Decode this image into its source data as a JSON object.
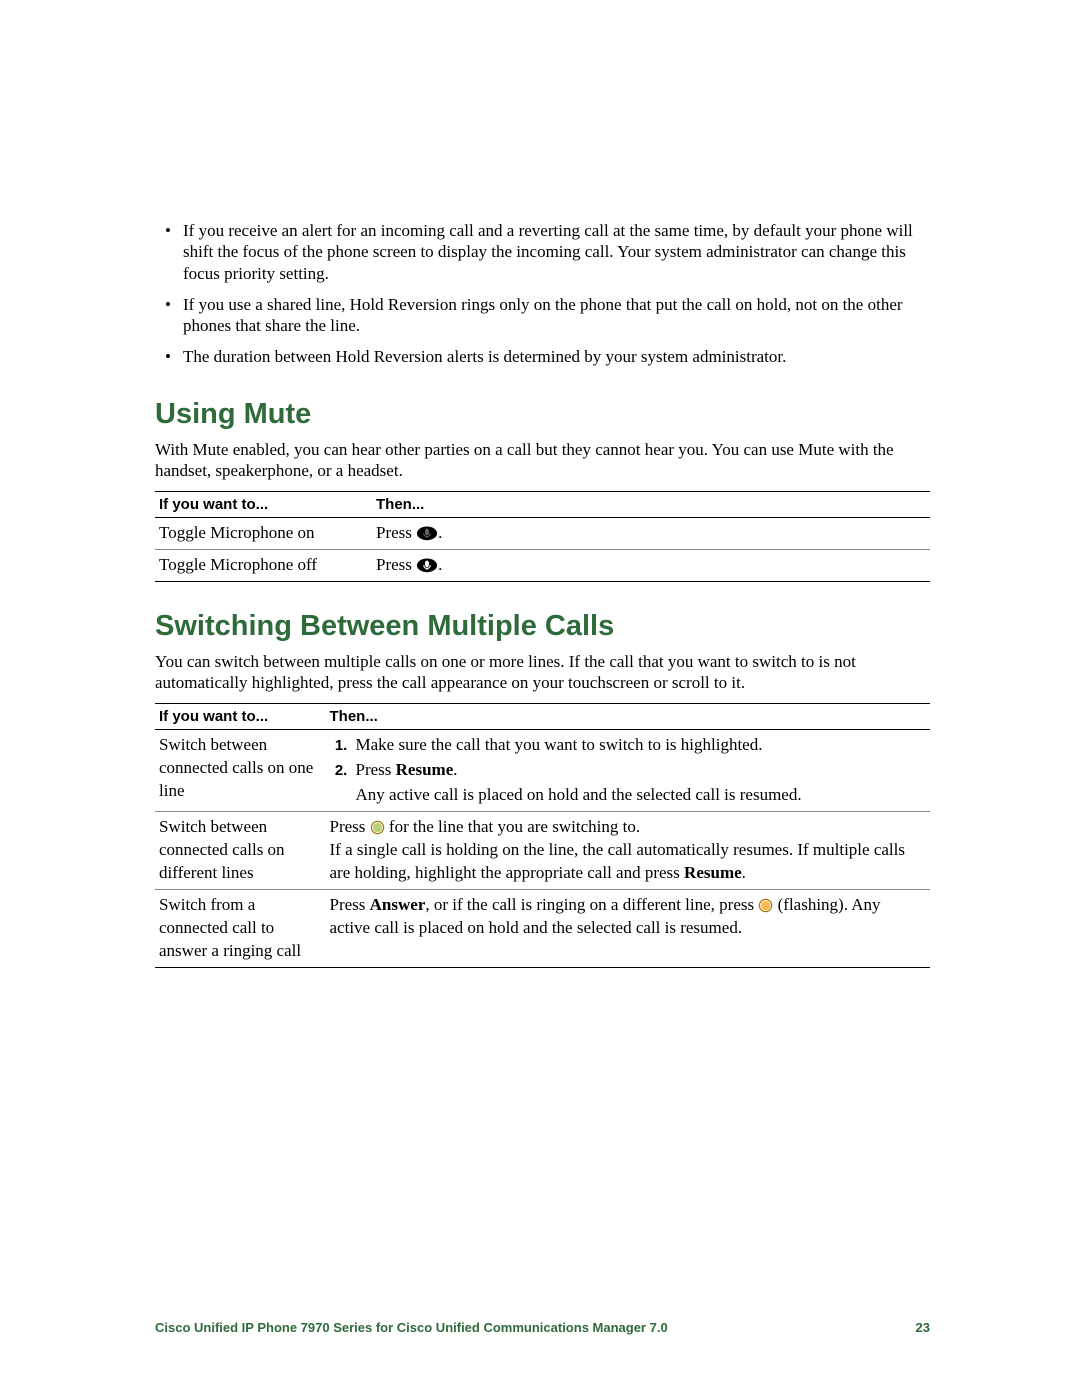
{
  "bullets": [
    "If you receive an alert for an incoming call and a reverting call at the same time, by default your phone will shift the focus of the phone screen to display the incoming call. Your system administrator can change this focus priority setting.",
    "If you use a shared line, Hold Reversion rings only on the phone that put the call on hold, not on the other phones that share the line.",
    "The duration between Hold Reversion alerts is determined by your system administrator."
  ],
  "mute": {
    "heading": "Using Mute",
    "intro": "With Mute enabled, you can hear other parties on a call but they cannot hear you. You can use Mute with the handset, speakerphone, or a headset.",
    "header_left": "If you want to...",
    "header_right": "Then...",
    "rows": [
      {
        "left": "Toggle Microphone on",
        "right_prefix": "Press ",
        "right_suffix": "."
      },
      {
        "left": "Toggle Microphone off",
        "right_prefix": "Press ",
        "right_suffix": "."
      }
    ]
  },
  "switch": {
    "heading": "Switching Between Multiple Calls",
    "intro": "You can switch between multiple calls on one or more lines. If the call that you want to switch to is not automatically highlighted, press the call appearance on your touchscreen or scroll to it.",
    "header_left": "If you want to...",
    "header_right": "Then...",
    "row1": {
      "left": "Switch between connected calls on one line",
      "step1": "Make sure the call that you want to switch to is highlighted.",
      "step2_pre": "Press ",
      "step2_bold": "Resume",
      "step2_post": ".",
      "after": "Any active call is placed on hold and the selected call is resumed."
    },
    "row2": {
      "left": "Switch between connected calls on different lines",
      "line1_pre": "Press ",
      "line1_post": " for the line that you are switching to.",
      "line2_pre": "If a single call is holding on the line, the call automatically resumes. If multiple calls are holding, highlight the appropriate call and press ",
      "line2_bold": "Resume",
      "line2_post": "."
    },
    "row3": {
      "left": "Switch from a connected call to answer a ringing call",
      "line1_pre": "Press ",
      "line1_bold": "Answer",
      "line1_mid": ", or if the call is ringing on a different line, press ",
      "line1_post": " (flashing). Any active call is placed on hold and the selected call is resumed."
    }
  },
  "footer": {
    "title": "Cisco Unified IP Phone 7970 Series for Cisco Unified Communications Manager 7.0",
    "page": "23"
  }
}
